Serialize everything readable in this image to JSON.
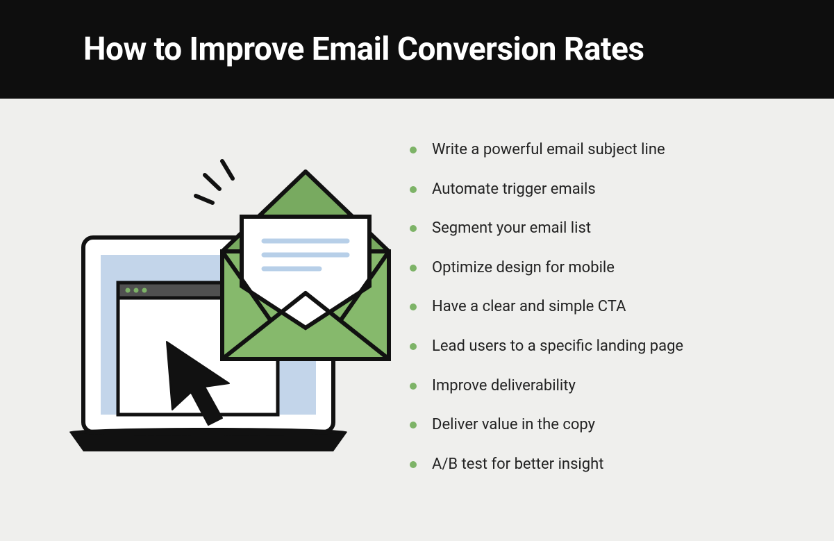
{
  "header": {
    "title": "How to Improve Email Conversion Rates"
  },
  "tips": [
    "Write a powerful email subject line",
    "Automate trigger emails",
    "Segment your email list",
    "Optimize design for mobile",
    "Have a clear and simple CTA",
    "Lead users to a specific landing page",
    "Improve deliverability",
    "Deliver value in the copy",
    "A/B test for better insight"
  ],
  "colors": {
    "accent": "#7db367",
    "header_bg": "#0e0e0e",
    "body_bg": "#efefed"
  },
  "illustration": {
    "description": "laptop-with-envelope-and-cursor",
    "icons": [
      "laptop-icon",
      "envelope-icon",
      "cursor-arrow-icon",
      "emphasis-lines-icon"
    ]
  }
}
